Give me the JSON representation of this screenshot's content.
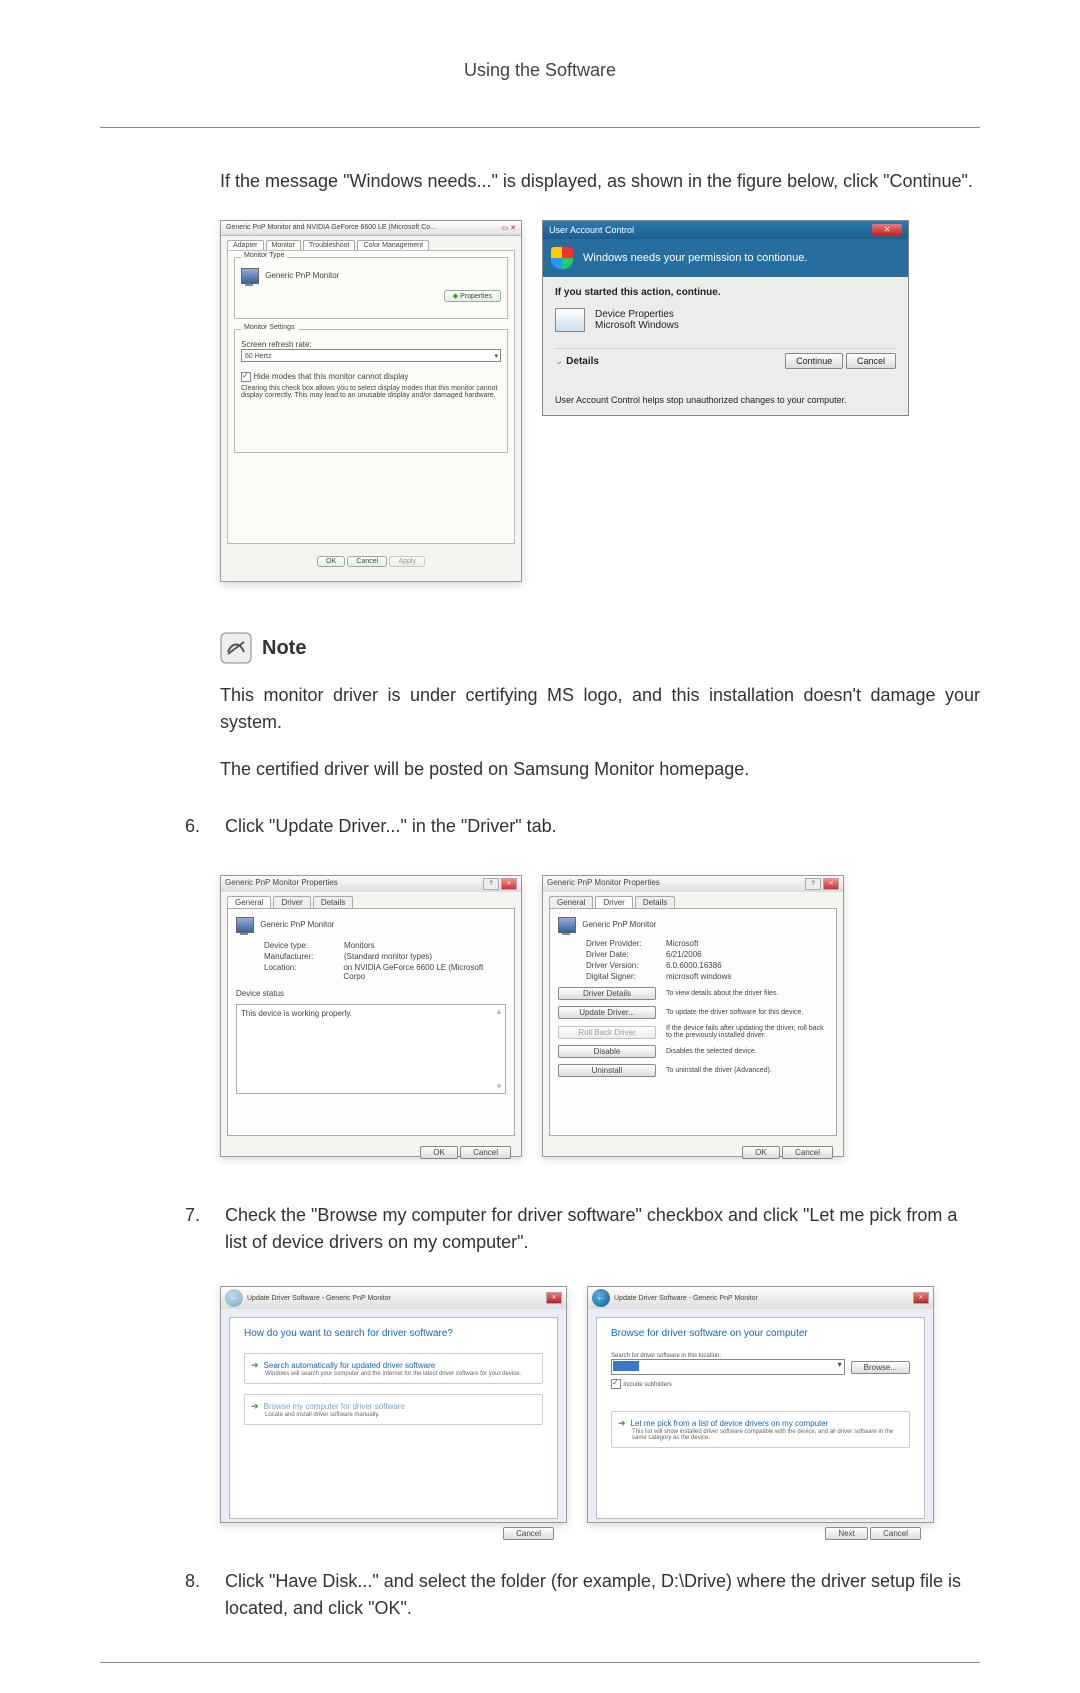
{
  "page_header": "Using the Software",
  "intro": "If the message \"Windows needs...\" is displayed, as shown in the figure below, click \"Continue\".",
  "note_label": "Note",
  "note_text1": "This monitor driver is under certifying MS logo, and this installation doesn't damage your system.",
  "note_text2": "The certified driver will be posted on Samsung Monitor homepage.",
  "step6_num": "6.",
  "step6_text": "Click \"Update Driver...\" in the \"Driver\" tab.",
  "step7_num": "7.",
  "step7_text": "Check the \"Browse my computer for driver software\" checkbox and click \"Let me pick from a list of device drivers on my computer\".",
  "step8_num": "8.",
  "step8_text": "Click \"Have Disk...\" and select the folder (for example, D:\\Drive) where the driver setup file is located, and click \"OK\".",
  "dlg1": {
    "title": "Generic PnP Monitor and NVIDIA GeForce 6600 LE (Microsoft Co...",
    "tabs": [
      "Adapter",
      "Monitor",
      "Troubleshoot",
      "Color Management"
    ],
    "group1_title": "Monitor Type",
    "monitor_name": "Generic PnP Monitor",
    "properties_btn": "Properties",
    "group2_title": "Monitor Settings",
    "refresh_label": "Screen refresh rate:",
    "refresh_value": "60 Hertz",
    "hide_cb": "Hide modes that this monitor cannot display",
    "hide_desc": "Clearing this check box allows you to select display modes that this monitor cannot display correctly. This may lead to an unusable display and/or damaged hardware.",
    "ok": "OK",
    "cancel": "Cancel",
    "apply": "Apply"
  },
  "uac": {
    "title": "User Account Control",
    "headline": "Windows needs your permission to contionue.",
    "subline": "If you started this action, continue.",
    "prog_name": "Device Properties",
    "prog_pub": "Microsoft Windows",
    "details": "Details",
    "continue_btn": "Continue",
    "cancel_btn": "Cancel",
    "footer": "User Account Control helps stop unauthorized changes to your computer."
  },
  "pnp_general": {
    "title": "Generic PnP Monitor Properties",
    "tabs": {
      "general": "General",
      "driver": "Driver",
      "details": "Details"
    },
    "name": "Generic PnP Monitor",
    "dt_label": "Device type:",
    "dt_value": "Monitors",
    "mf_label": "Manufacturer:",
    "mf_value": "(Standard monitor types)",
    "loc_label": "Location:",
    "loc_value": "on NVIDIA GeForce 6600 LE (Microsoft Corpo",
    "status_legend": "Device status",
    "status_text": "This device is working properly.",
    "ok": "OK",
    "cancel": "Cancel"
  },
  "pnp_driver": {
    "title": "Generic PnP Monitor Properties",
    "name": "Generic PnP Monitor",
    "dp_label": "Driver Provider:",
    "dp_value": "Microsoft",
    "dd_label": "Driver Date:",
    "dd_value": "6/21/2006",
    "dv_label": "Driver Version:",
    "dv_value": "6.0.6000.16386",
    "ds_label": "Digital Signer:",
    "ds_value": "microsoft windows",
    "btn1": "Driver Details",
    "desc1": "To view details about the driver files.",
    "btn2": "Update Driver...",
    "desc2": "To update the driver software for this device.",
    "btn3": "Roll Back Driver",
    "desc3": "If the device fails after updating the driver, roll back to the previously installed driver.",
    "btn4": "Disable",
    "desc4": "Disables the selected device.",
    "btn5": "Uninstall",
    "desc5": "To uninstall the driver (Advanced).",
    "ok": "OK",
    "cancel": "Cancel"
  },
  "wiz1": {
    "title": "Update Driver Software - Generic PnP Monitor",
    "question": "How do you want to search for driver software?",
    "opt1_h": "Search automatically for updated driver software",
    "opt1_s": "Windows will search your computer and the Internet for the latest driver software for your device.",
    "opt2_h": "Browse my computer for driver software",
    "opt2_s": "Locate and install driver software manually.",
    "cancel": "Cancel"
  },
  "wiz2": {
    "title": "Update Driver Software - Generic PnP Monitor",
    "header": "Browse for driver software on your computer",
    "loc_label": "Search for driver software in this location:",
    "browse": "Browse...",
    "include_sub": "Include subfolders",
    "pick_h": "Let me pick from a list of device drivers on my computer",
    "pick_s": "This list will show installed driver software compatible with the device, and all driver software in the same category as the device.",
    "next": "Next",
    "cancel": "Cancel"
  }
}
